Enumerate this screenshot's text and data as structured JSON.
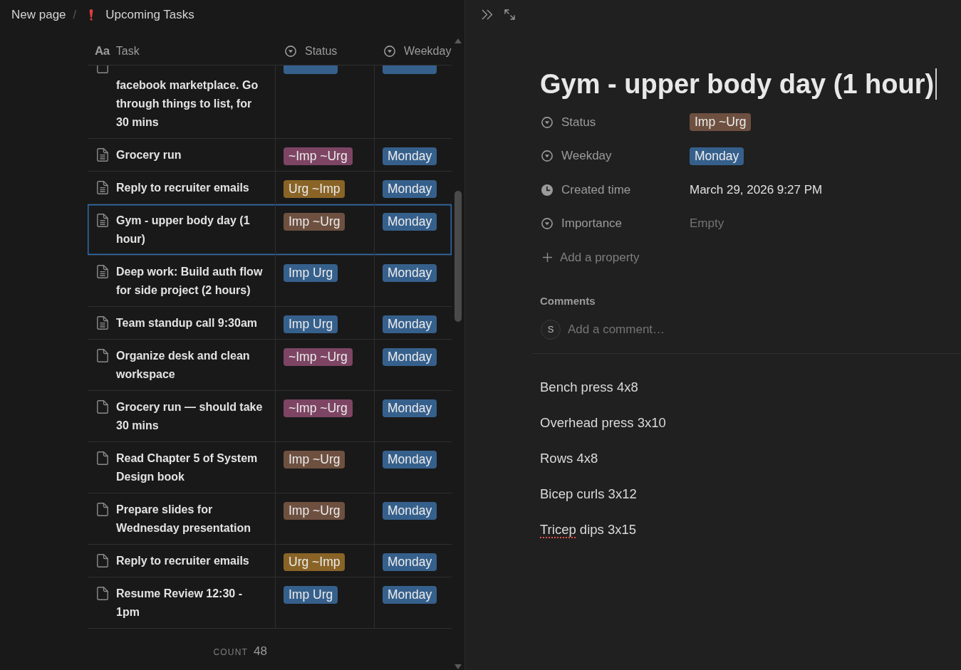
{
  "breadcrumb": {
    "separator": "/",
    "items": [
      {
        "kind": "page",
        "label": "New page"
      },
      {
        "kind": "database",
        "label": "Upcoming Tasks"
      }
    ]
  },
  "table": {
    "columns": [
      {
        "kind": "title",
        "glyph": "Aa",
        "label": "Task"
      },
      {
        "kind": "select",
        "label": "Status"
      },
      {
        "kind": "select",
        "label": "Weekday"
      }
    ],
    "rows": [
      {
        "kind": "cut",
        "task": "facebook marketplace. Go through things to list, for 30 mins",
        "has_content": false,
        "selected": false,
        "status": {
          "color": "#36608c"
        },
        "weekday": {
          "color": "#36608c"
        }
      },
      {
        "kind": "full",
        "task": "Grocery run",
        "has_content": true,
        "selected": false,
        "status": {
          "text": "~Imp ~Urg",
          "color": "#7d4563"
        },
        "weekday": {
          "text": "Monday",
          "color": "#36608c"
        }
      },
      {
        "kind": "full",
        "task": "Reply to recruiter emails",
        "has_content": true,
        "selected": false,
        "status": {
          "text": "Urg ~Imp",
          "color": "#896426"
        },
        "weekday": {
          "text": "Monday",
          "color": "#36608c"
        }
      },
      {
        "kind": "full",
        "task": "Gym - upper body day (1 hour)",
        "has_content": true,
        "selected": true,
        "status": {
          "text": "Imp ~Urg",
          "color": "#6e5040"
        },
        "weekday": {
          "text": "Monday",
          "color": "#36608c"
        }
      },
      {
        "kind": "full",
        "task": "Deep work: Build auth flow for side project (2 hours)",
        "has_content": true,
        "selected": false,
        "status": {
          "text": "Imp Urg",
          "color": "#36608c"
        },
        "weekday": {
          "text": "Monday",
          "color": "#36608c"
        }
      },
      {
        "kind": "full",
        "task": "Team standup call 9:30am",
        "has_content": true,
        "selected": false,
        "status": {
          "text": "Imp Urg",
          "color": "#36608c"
        },
        "weekday": {
          "text": "Monday",
          "color": "#36608c"
        }
      },
      {
        "kind": "full",
        "task": "Organize desk and clean workspace",
        "has_content": false,
        "selected": false,
        "status": {
          "text": "~Imp ~Urg",
          "color": "#7d4563"
        },
        "weekday": {
          "text": "Monday",
          "color": "#36608c"
        }
      },
      {
        "kind": "full",
        "task": "Grocery run — should take 30 mins",
        "has_content": false,
        "selected": false,
        "status": {
          "text": "~Imp ~Urg",
          "color": "#7d4563"
        },
        "weekday": {
          "text": "Monday",
          "color": "#36608c"
        }
      },
      {
        "kind": "full",
        "task": "Read Chapter 5 of System Design book",
        "has_content": false,
        "selected": false,
        "status": {
          "text": "Imp ~Urg",
          "color": "#6e5040"
        },
        "weekday": {
          "text": "Monday",
          "color": "#36608c"
        }
      },
      {
        "kind": "full",
        "task": "Prepare slides for Wednesday presentation",
        "has_content": false,
        "selected": false,
        "status": {
          "text": "Imp ~Urg",
          "color": "#6e5040"
        },
        "weekday": {
          "text": "Monday",
          "color": "#36608c"
        }
      },
      {
        "kind": "full",
        "task": "Reply to recruiter emails",
        "has_content": false,
        "selected": false,
        "status": {
          "text": "Urg ~Imp",
          "color": "#896426"
        },
        "weekday": {
          "text": "Monday",
          "color": "#36608c"
        }
      },
      {
        "kind": "full",
        "task": "Resume Review 12:30 - 1pm",
        "has_content": false,
        "selected": false,
        "status": {
          "text": "Imp Urg",
          "color": "#36608c"
        },
        "weekday": {
          "text": "Monday",
          "color": "#36608c"
        }
      }
    ],
    "count_label": "COUNT",
    "count": "48"
  },
  "detail": {
    "title": "Gym - upper body day (1 hour)",
    "title_focused": true,
    "properties": [
      {
        "kind": "select",
        "label": "Status",
        "value": {
          "text": "Imp ~Urg",
          "color": "#6e5040"
        }
      },
      {
        "kind": "select",
        "label": "Weekday",
        "value": {
          "text": "Monday",
          "color": "#36608c"
        }
      },
      {
        "kind": "created_time",
        "label": "Created time",
        "value": {
          "text": "March 29, 2026 9:27 PM"
        }
      },
      {
        "kind": "select",
        "label": "Importance",
        "placeholder": "Empty"
      }
    ],
    "add_property": "Add a property",
    "comments": {
      "heading": "Comments",
      "avatar": "S",
      "placeholder": "Add a comment…"
    },
    "body": [
      {
        "runs": [
          {
            "text": "Bench press 4x8",
            "misspelled": false
          }
        ]
      },
      {
        "runs": [
          {
            "text": "Overhead press 3x10",
            "misspelled": false
          }
        ]
      },
      {
        "runs": [
          {
            "text": "Rows 4x8",
            "misspelled": false
          }
        ]
      },
      {
        "runs": [
          {
            "text": "Bicep curls 3x12",
            "misspelled": false
          }
        ]
      },
      {
        "runs": [
          {
            "text": "Tricep",
            "misspelled": true
          },
          {
            "text": " dips 3x15",
            "misspelled": false
          }
        ]
      }
    ]
  }
}
